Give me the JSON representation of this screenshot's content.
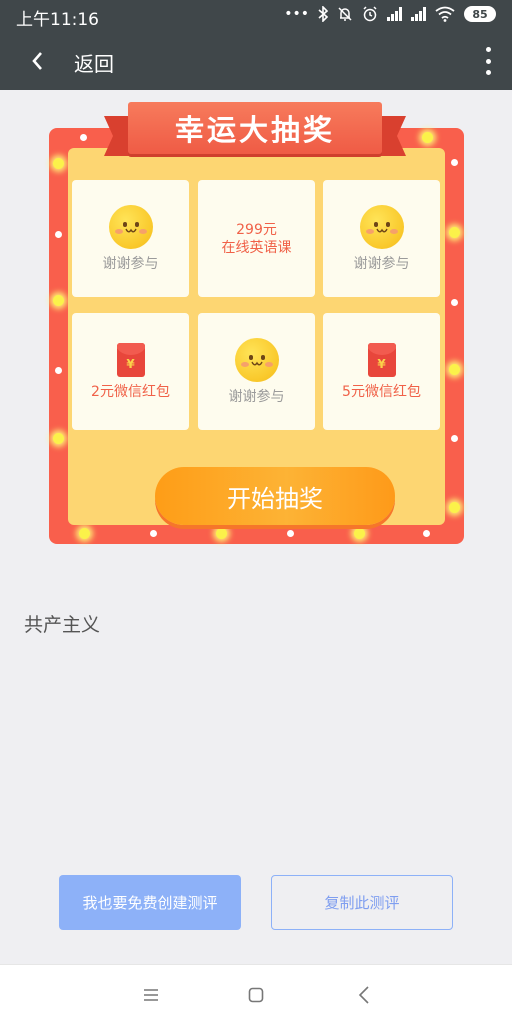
{
  "status_bar": {
    "time": "上午11:16",
    "battery": "85"
  },
  "app_bar": {
    "back_label": "返回",
    "icons": [
      "chevron-left-icon",
      "more-vertical-icon"
    ]
  },
  "lottery": {
    "title": "幸运大抽奖",
    "cells": [
      {
        "type": "smiley",
        "label": "谢谢参与"
      },
      {
        "type": "prize",
        "amount": "299元",
        "name": "在线英语课"
      },
      {
        "type": "smiley",
        "label": "谢谢参与"
      },
      {
        "type": "envelope",
        "label": "2元微信红包"
      },
      {
        "type": "smiley",
        "label": "谢谢参与"
      },
      {
        "type": "envelope",
        "label": "5元微信红包"
      }
    ],
    "envelope_symbol": "¥",
    "start_button": "开始抽奖"
  },
  "content": {
    "text": "共产主义"
  },
  "actions": {
    "create_label": "我也要免费创建测评",
    "copy_label": "复制此测评"
  },
  "colors": {
    "header": "#40474a",
    "frame": "#f95f4c",
    "inner": "#fdd672",
    "button_orange": "#fe9d17",
    "action_blue": "#8db1f8"
  }
}
